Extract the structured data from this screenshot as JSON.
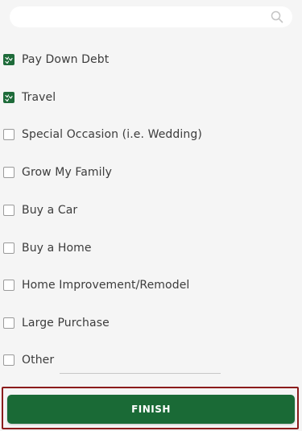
{
  "search": {
    "value": "",
    "placeholder": "",
    "icon": "search-icon"
  },
  "goals": [
    {
      "label": "Pay Down Debt",
      "checked": true
    },
    {
      "label": "Travel",
      "checked": true
    },
    {
      "label": "Special Occasion (i.e. Wedding)",
      "checked": false
    },
    {
      "label": "Grow My Family",
      "checked": false
    },
    {
      "label": "Buy a Car",
      "checked": false
    },
    {
      "label": "Buy a Home",
      "checked": false
    },
    {
      "label": "Home Improvement/Remodel",
      "checked": false
    },
    {
      "label": "Large Purchase",
      "checked": false
    },
    {
      "label": "Other",
      "checked": false
    }
  ],
  "other_field": {
    "value": "",
    "placeholder": ""
  },
  "finish_label": "FINISH",
  "colors": {
    "accent_green": "#1a6a36",
    "highlight_border": "#8b1c1c",
    "background": "#f5f5f5"
  }
}
